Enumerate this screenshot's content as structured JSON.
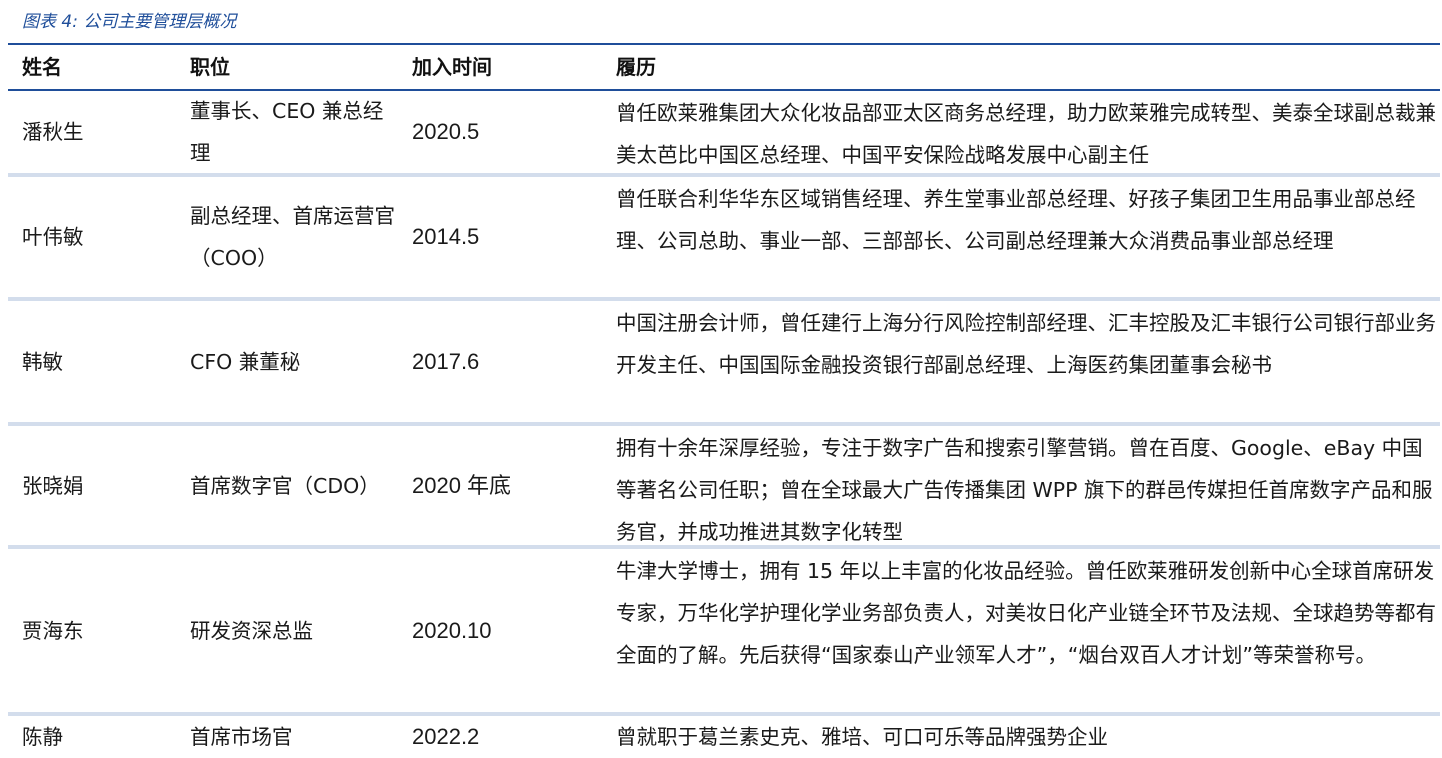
{
  "caption": "图表 4:  公司主要管理层概况",
  "headers": {
    "name": "姓名",
    "position": "职位",
    "join_time": "加入时间",
    "resume": "履历"
  },
  "rows": [
    {
      "name": "潘秋生",
      "position": "董事长、CEO 兼总经理",
      "join_time": "2020.5",
      "resume": "曾任欧莱雅集团大众化妆品部亚太区商务总经理，助力欧莱雅完成转型、美泰全球副总裁兼美太芭比中国区总经理、中国平安保险战略发展中心副主任"
    },
    {
      "name": "叶伟敏",
      "position": "副总经理、首席运营官（COO）",
      "join_time": "2014.5",
      "resume": "曾任联合利华华东区域销售经理、养生堂事业部总经理、好孩子集团卫生用品事业部总经理、公司总助、事业一部、三部部长、公司副总经理兼大众消费品事业部总经理"
    },
    {
      "name": "韩敏",
      "position": "CFO 兼董秘",
      "join_time": "2017.6",
      "resume": "中国注册会计师，曾任建行上海分行风险控制部经理、汇丰控股及汇丰银行公司银行部业务开发主任、中国国际金融投资银行部副总经理、上海医药集团董事会秘书"
    },
    {
      "name": "张晓娟",
      "position": "首席数字官（CDO）",
      "join_time": "2020 年底",
      "resume": "拥有十余年深厚经验，专注于数字广告和搜索引擎营销。曾在百度、Google、eBay 中国等著名公司任职；曾在全球最大广告传播集团 WPP 旗下的群邑传媒担任首席数字产品和服务官，并成功推进其数字化转型"
    },
    {
      "name": "贾海东",
      "position": "研发资深总监",
      "join_time": "2020.10",
      "resume": "牛津大学博士，拥有 15 年以上丰富的化妆品经验。曾任欧莱雅研发创新中心全球首席研发专家，万华化学护理化学业务部负责人，对美妆日化产业链全环节及法规、全球趋势等都有全面的了解。先后获得“国家泰山产业领军人才”，“烟台双百人才计划”等荣誉称号。"
    },
    {
      "name": "陈静",
      "position": "首席市场官",
      "join_time": "2022.2",
      "resume": "曾就职于葛兰素史克、雅培、可口可乐等品牌强势企业"
    }
  ]
}
